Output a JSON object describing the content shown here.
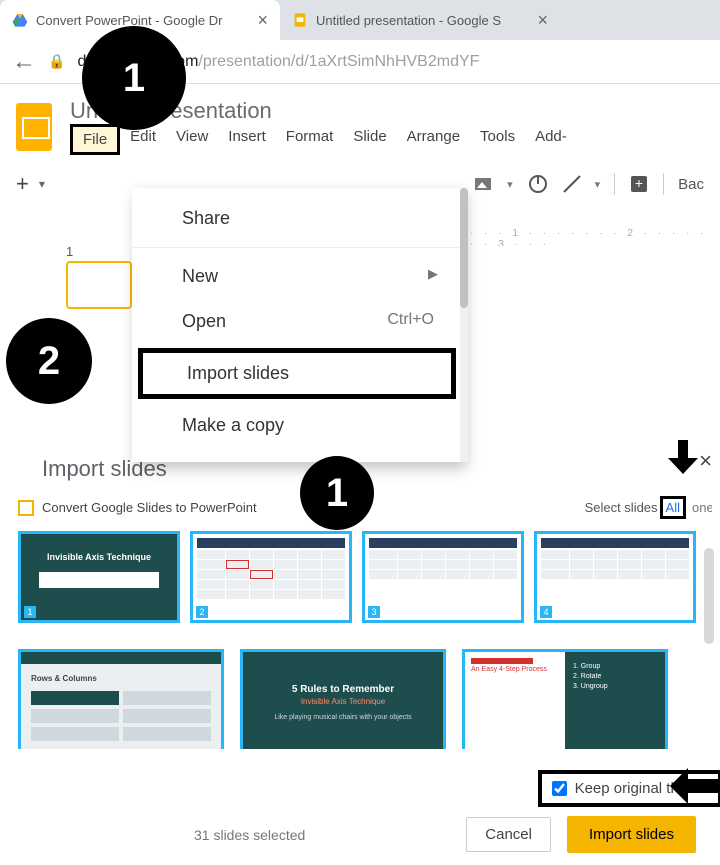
{
  "tabs": [
    {
      "label": "Convert PowerPoint - Google Dr"
    },
    {
      "label": "Untitled presentation - Google S"
    }
  ],
  "url": {
    "domain": "docs.google.com",
    "path": "/presentation/d/1aXrtSimNhHVB2mdYF"
  },
  "doc_title": "Untitled presentation",
  "menus": [
    "File",
    "Edit",
    "View",
    "Insert",
    "Format",
    "Slide",
    "Arrange",
    "Tools",
    "Add-"
  ],
  "toolbar": {
    "back_label": "Bac"
  },
  "slide_panel": {
    "num": "1"
  },
  "file_menu": {
    "share": "Share",
    "new": "New",
    "open": "Open",
    "open_shortcut": "Ctrl+O",
    "import": "Import slides",
    "make_copy": "Make a copy"
  },
  "steps": {
    "s1": "1",
    "s2": "2"
  },
  "dialog": {
    "title": "Import slides",
    "file_name": "Convert Google Slides to PowerPoint",
    "select_label": "Select slides",
    "select_all": "All",
    "select_none": "one",
    "keep_theme": "Keep original theme",
    "count": "31 slides selected",
    "cancel": "Cancel",
    "import_btn": "Import slides"
  },
  "thumbs": {
    "t1_title": "Invisible Axis Technique",
    "t5_title": "Rows & Columns",
    "t6_title": "5 Rules to Remember",
    "t6_sub": "Invisible Axis Technique",
    "t6_foot": "Like playing musical chairs with your objects",
    "t7_head": "An Easy 4-Step Process",
    "t7_l1": "1. Group",
    "t7_l2": "2. Rotate",
    "t7_l3": "3. Ungroup"
  }
}
